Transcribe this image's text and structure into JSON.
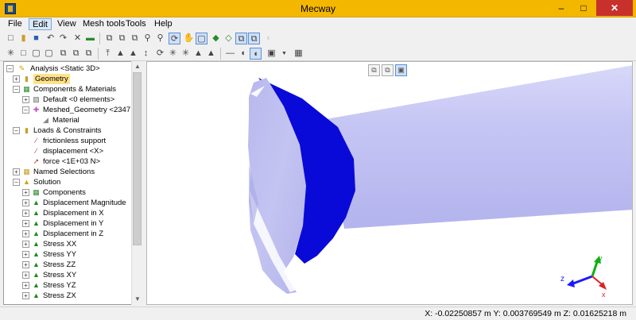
{
  "window": {
    "title": "Mecway",
    "minimize": "–",
    "maximize": "□",
    "close": "✕"
  },
  "menu": {
    "items": [
      "File",
      "Edit",
      "View",
      "Mesh tools",
      "Tools",
      "Help"
    ],
    "highlighted": "Edit"
  },
  "tree": {
    "rows": [
      {
        "label": "Analysis <Static 3D>",
        "icon": "ruler-icon"
      },
      {
        "label": "Geometry",
        "icon": "folder-icon",
        "selected": true
      },
      {
        "label": "Components & Materials",
        "icon": "components-icon"
      },
      {
        "label": "Default <0 elements>",
        "icon": "component-icon"
      },
      {
        "label": "Meshed_Geometry <2347 eler",
        "icon": "component-icon"
      },
      {
        "label": "Material",
        "icon": "material-icon"
      },
      {
        "label": "Loads & Constraints",
        "icon": "loads-icon"
      },
      {
        "label": "frictionless support",
        "icon": "constraint-icon"
      },
      {
        "label": "displacement <X>",
        "icon": "constraint-icon"
      },
      {
        "label": "force <1E+03 N>",
        "icon": "force-icon"
      },
      {
        "label": "Named Selections",
        "icon": "named-selections-icon"
      },
      {
        "label": "Solution",
        "icon": "warning-icon"
      },
      {
        "label": "Components",
        "icon": "components-icon"
      },
      {
        "label": "Displacement Magnitude",
        "icon": "result-icon"
      },
      {
        "label": "Displacement in X",
        "icon": "result-icon"
      },
      {
        "label": "Displacement in Y",
        "icon": "result-icon"
      },
      {
        "label": "Displacement in Z",
        "icon": "result-icon"
      },
      {
        "label": "Stress XX",
        "icon": "result-icon"
      },
      {
        "label": "Stress YY",
        "icon": "result-icon"
      },
      {
        "label": "Stress ZZ",
        "icon": "result-icon"
      },
      {
        "label": "Stress XY",
        "icon": "result-icon"
      },
      {
        "label": "Stress YZ",
        "icon": "result-icon"
      },
      {
        "label": "Stress ZX",
        "icon": "result-icon"
      }
    ]
  },
  "viewport": {
    "axes": {
      "x": "x",
      "y": "y",
      "z": "z"
    }
  },
  "status": {
    "coordinates": "X: -0.02250857 m Y: 0.003769549 m Z: 0.01625218 m"
  },
  "colors": {
    "titlebar": "#f4b700",
    "close_button": "#c7302b",
    "model_light": "#c9c9f6",
    "model_dark": "#0a0ad8",
    "selection": "#ffe28a"
  }
}
